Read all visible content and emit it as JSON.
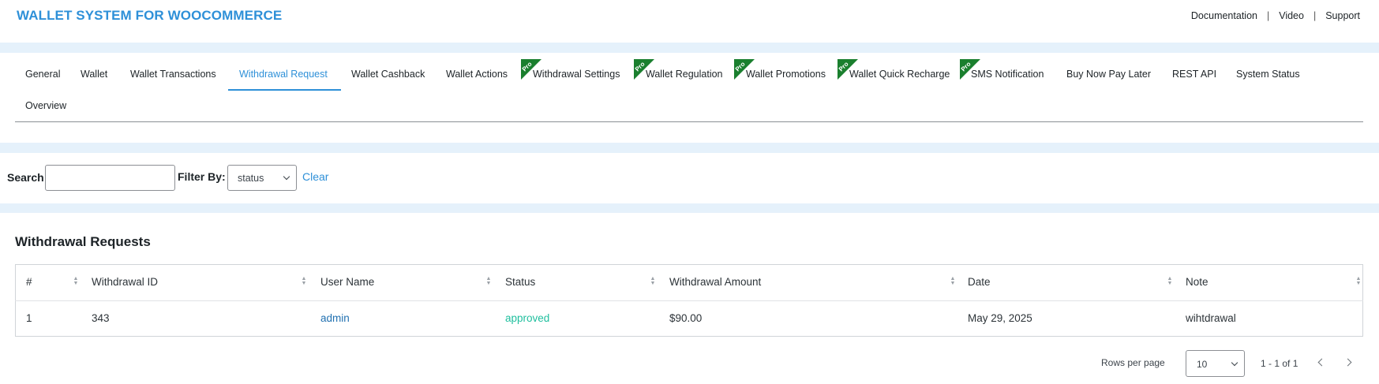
{
  "header": {
    "title": "WALLET SYSTEM FOR WOOCOMMERCE",
    "links": [
      "Documentation",
      "Video",
      "Support"
    ],
    "separator": "|"
  },
  "tabs": {
    "row1": [
      "General",
      "Wallet",
      "Wallet Transactions",
      "Withdrawal Request",
      "Wallet Cashback",
      "Wallet Actions",
      "Withdrawal Settings",
      "Wallet Regulation",
      "Wallet Promotions",
      "Wallet Quick Recharge",
      "SMS Notification",
      "Buy Now Pay Later",
      "REST API",
      "System Status"
    ],
    "row2": [
      "Overview"
    ],
    "active": "Withdrawal Request",
    "pro_badge": "Pro"
  },
  "filters": {
    "search_label": "Search",
    "search_value": "",
    "filter_label": "Filter By:",
    "filter_value": "status",
    "clear_label": "Clear"
  },
  "table": {
    "title": "Withdrawal Requests",
    "columns": [
      "#",
      "Withdrawal ID",
      "User Name",
      "Status",
      "Withdrawal Amount",
      "Date",
      "Note"
    ],
    "rows": [
      {
        "num": "1",
        "id": "343",
        "user": "admin",
        "status": "approved",
        "amount": "$90.00",
        "date": "May 29, 2025",
        "note": "wihtdrawal"
      }
    ]
  },
  "pagination": {
    "rows_per_page_label": "Rows per page",
    "rows_per_page": "10",
    "range": "1 - 1 of 1"
  },
  "colors": {
    "accent": "#2e90d8",
    "band": "#e5f1fb",
    "pro_badge": "#1a7f2e",
    "status_approved": "#1fbf9e",
    "link": "#2271b1"
  }
}
